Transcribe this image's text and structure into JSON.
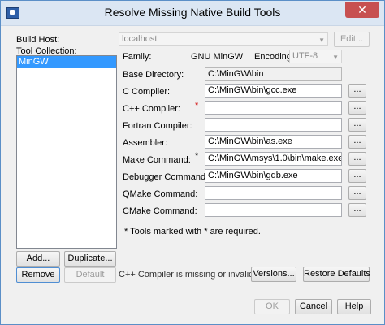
{
  "window": {
    "title": "Resolve Missing Native Build Tools",
    "close_glyph": "✕",
    "accent_color": "#5b8fc7",
    "close_color": "#c75050"
  },
  "build_host": {
    "label": "Build Host:",
    "value": "localhost",
    "edit_label": "Edit..."
  },
  "tool_collection": {
    "label": "Tool Collection:",
    "items": [
      "MinGW"
    ],
    "selected": "MinGW"
  },
  "family": {
    "label": "Family:",
    "value": "GNU MinGW"
  },
  "encoding": {
    "label": "Encoding:",
    "value": "UTF-8"
  },
  "tools": {
    "browse_label": "...",
    "base_directory": {
      "label": "Base Directory:",
      "value": "C:\\MinGW\\bin"
    },
    "c_compiler": {
      "label": "C Compiler:",
      "value": "C:\\MinGW\\bin\\gcc.exe"
    },
    "cpp_compiler": {
      "label": "C++ Compiler:",
      "value": "",
      "required_marker": "*"
    },
    "fortran_compiler": {
      "label": "Fortran Compiler:",
      "value": ""
    },
    "assembler": {
      "label": "Assembler:",
      "value": "C:\\MinGW\\bin\\as.exe"
    },
    "make_command": {
      "label": "Make Command:",
      "value": "C:\\MinGW\\msys\\1.0\\bin\\make.exe",
      "required_marker": "*"
    },
    "debugger_command": {
      "label": "Debugger Command:",
      "value": "C:\\MinGW\\bin\\gdb.exe"
    },
    "qmake_command": {
      "label": "QMake Command:",
      "value": ""
    },
    "cmake_command": {
      "label": "CMake Command:",
      "value": ""
    }
  },
  "note": "* Tools marked with * are required.",
  "status": "C++ Compiler is missing or invalid",
  "buttons": {
    "add": "Add...",
    "duplicate": "Duplicate...",
    "remove": "Remove",
    "default": "Default",
    "versions": "Versions...",
    "restore_defaults": "Restore Defaults",
    "ok": "OK",
    "cancel": "Cancel",
    "help": "Help"
  }
}
